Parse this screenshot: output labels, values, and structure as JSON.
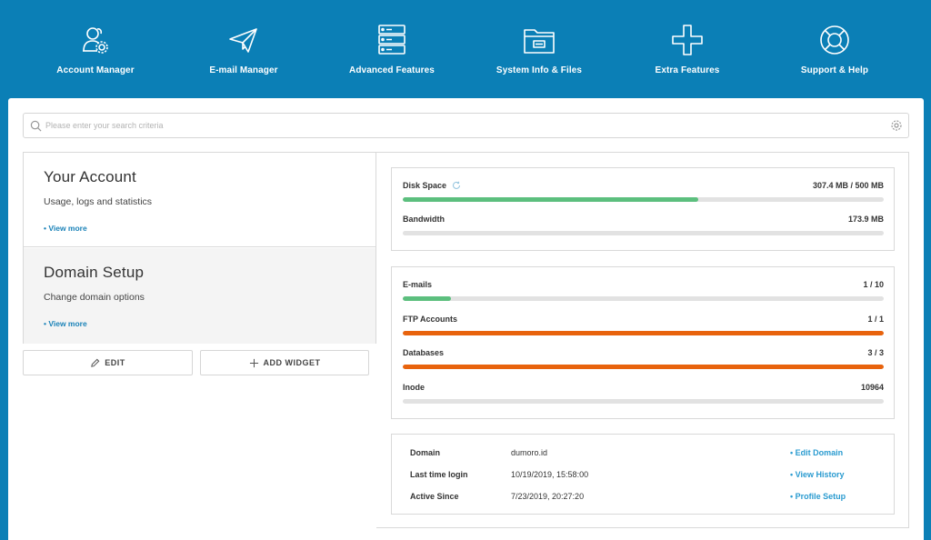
{
  "nav": [
    {
      "label": "Account Manager",
      "icon": "users-gear-icon"
    },
    {
      "label": "E-mail Manager",
      "icon": "paper-plane-icon"
    },
    {
      "label": "Advanced Features",
      "icon": "server-icon"
    },
    {
      "label": "System Info & Files",
      "icon": "folder-icon"
    },
    {
      "label": "Extra Features",
      "icon": "plus-icon"
    },
    {
      "label": "Support & Help",
      "icon": "lifebuoy-icon"
    }
  ],
  "search": {
    "placeholder": "Please enter your search criteria"
  },
  "widgets": [
    {
      "title": "Your Account",
      "desc": "Usage, logs and statistics",
      "link": "• View more"
    },
    {
      "title": "Domain Setup",
      "desc": "Change domain options",
      "link": "• View more"
    }
  ],
  "buttons": {
    "edit": "EDIT",
    "add_widget": "ADD WIDGET"
  },
  "usage": [
    {
      "label": "Disk Space",
      "value": "307.4 MB / 500 MB",
      "fraction": 0.615,
      "color": "green"
    },
    {
      "label": "Bandwidth",
      "value": "173.9 MB",
      "fraction": 0,
      "color": "green"
    }
  ],
  "limits": [
    {
      "label": "E-mails",
      "value": "1 / 10",
      "fraction": 0.1,
      "color": "green"
    },
    {
      "label": "FTP Accounts",
      "value": "1 / 1",
      "fraction": 1,
      "color": "orange"
    },
    {
      "label": "Databases",
      "value": "3 / 3",
      "fraction": 1,
      "color": "orange"
    },
    {
      "label": "Inode",
      "value": "10964",
      "fraction": 0,
      "color": "green"
    }
  ],
  "info": [
    {
      "key": "Domain",
      "value": "dumoro.id",
      "link": "• Edit Domain"
    },
    {
      "key": "Last time login",
      "value": "10/19/2019, 15:58:00",
      "link": "• View History"
    },
    {
      "key": "Active Since",
      "value": "7/23/2019, 20:27:20",
      "link": "• Profile Setup"
    }
  ]
}
